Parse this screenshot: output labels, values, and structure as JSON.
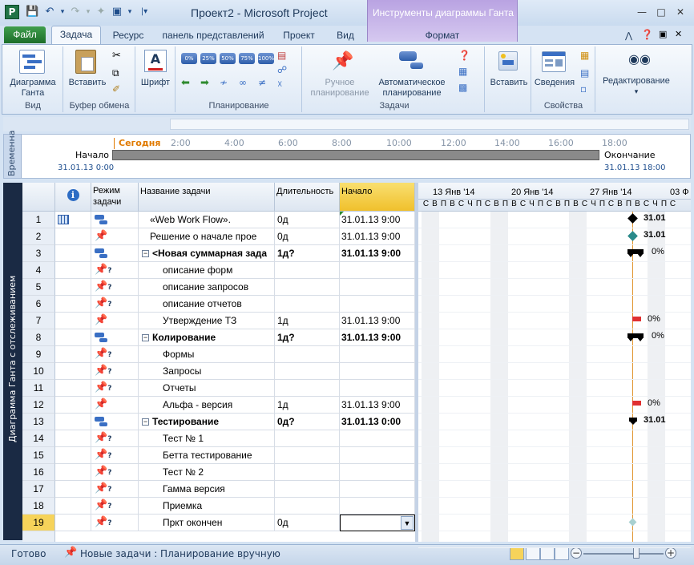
{
  "window": {
    "title": "Проект2 - Microsoft Project",
    "context_tab_title": "Инструменты диаграммы Ганта"
  },
  "ribbon_tabs": {
    "file": "Файл",
    "task": "Задача",
    "resource": "Ресурс",
    "view_panel": "панель представлений",
    "project": "Проект",
    "view": "Вид",
    "format": "Формат"
  },
  "ribbon": {
    "gantt_button": "Диаграмма\nГанта",
    "paste_button": "Вставить",
    "font_button": "Шрифт",
    "manual_schedule": "Ручное\nпланирование",
    "auto_schedule": "Автоматическое\nпланирование",
    "insert_button": "Вставить",
    "info_button": "Сведения",
    "editing_button": "Редактирование",
    "groups": {
      "view": "Вид",
      "clipboard": "Буфер обмена",
      "schedule": "Планирование",
      "tasks": "Задачи",
      "properties": "Свойства"
    },
    "percent_buttons": [
      "0%",
      "25%",
      "50%",
      "75%",
      "100%"
    ]
  },
  "timeline": {
    "side_label": "Временна",
    "today": "Сегодня",
    "ticks": [
      "2:00",
      "4:00",
      "6:00",
      "8:00",
      "10:00",
      "12:00",
      "14:00",
      "16:00",
      "18:00"
    ],
    "start_label": "Начало",
    "start_date": "31.01.13 0:00",
    "end_label": "Окончание",
    "end_date": "31.01.13 18:00"
  },
  "view_bar_label": "Диаграмма Ганта с отслеживанием",
  "grid": {
    "headers": {
      "mode": "Режим\nзадачи",
      "name": "Название задачи",
      "duration": "Длительность",
      "start": "Начало"
    },
    "rows": [
      {
        "id": "1",
        "mode": "auto",
        "name": "«Web Work Flow».",
        "duration": "0д",
        "start": "31.01.13 9:00",
        "bold": false,
        "indent": 1,
        "collapse": false,
        "indicator": "table"
      },
      {
        "id": "2",
        "mode": "manual",
        "name": "Решение о начале прое",
        "duration": "0д",
        "start": "31.01.13 9:00",
        "bold": false,
        "indent": 1,
        "collapse": false
      },
      {
        "id": "3",
        "mode": "auto",
        "name": "<Новая суммарная зада",
        "duration": "1д?",
        "start": "31.01.13 9:00",
        "bold": true,
        "indent": 0,
        "collapse": true
      },
      {
        "id": "4",
        "mode": "manual-q",
        "name": "описание форм",
        "duration": "",
        "start": "",
        "bold": false,
        "indent": 2,
        "collapse": false
      },
      {
        "id": "5",
        "mode": "manual-q",
        "name": "описание запросов",
        "duration": "",
        "start": "",
        "bold": false,
        "indent": 2,
        "collapse": false
      },
      {
        "id": "6",
        "mode": "manual-q",
        "name": "описание отчетов",
        "duration": "",
        "start": "",
        "bold": false,
        "indent": 2,
        "collapse": false
      },
      {
        "id": "7",
        "mode": "manual",
        "name": "Утверждение ТЗ",
        "duration": "1д",
        "start": "31.01.13 9:00",
        "bold": false,
        "indent": 2,
        "collapse": false
      },
      {
        "id": "8",
        "mode": "auto",
        "name": "Колирование",
        "duration": "1д?",
        "start": "31.01.13 9:00",
        "bold": true,
        "indent": 0,
        "collapse": true
      },
      {
        "id": "9",
        "mode": "manual-q",
        "name": "Формы",
        "duration": "",
        "start": "",
        "bold": false,
        "indent": 2,
        "collapse": false
      },
      {
        "id": "10",
        "mode": "manual-q",
        "name": "Запросы",
        "duration": "",
        "start": "",
        "bold": false,
        "indent": 2,
        "collapse": false
      },
      {
        "id": "11",
        "mode": "manual-q",
        "name": "Отчеты",
        "duration": "",
        "start": "",
        "bold": false,
        "indent": 2,
        "collapse": false
      },
      {
        "id": "12",
        "mode": "manual",
        "name": "Альфа - версия",
        "duration": "1д",
        "start": "31.01.13 9:00",
        "bold": false,
        "indent": 2,
        "collapse": false
      },
      {
        "id": "13",
        "mode": "auto",
        "name": "Тестирование",
        "duration": "0д?",
        "start": "31.01.13 0:00",
        "bold": true,
        "indent": 0,
        "collapse": true
      },
      {
        "id": "14",
        "mode": "manual-q",
        "name": "Тест № 1",
        "duration": "",
        "start": "",
        "bold": false,
        "indent": 2,
        "collapse": false
      },
      {
        "id": "15",
        "mode": "manual-q",
        "name": "Бетта тестирование",
        "duration": "",
        "start": "",
        "bold": false,
        "indent": 2,
        "collapse": false
      },
      {
        "id": "16",
        "mode": "manual-q",
        "name": "Тест № 2",
        "duration": "",
        "start": "",
        "bold": false,
        "indent": 2,
        "collapse": false
      },
      {
        "id": "17",
        "mode": "manual-q",
        "name": "Гамма версия",
        "duration": "",
        "start": "",
        "bold": false,
        "indent": 2,
        "collapse": false
      },
      {
        "id": "18",
        "mode": "manual-q",
        "name": "Приемка",
        "duration": "",
        "start": "",
        "bold": false,
        "indent": 2,
        "collapse": false
      },
      {
        "id": "19",
        "mode": "manual-q",
        "name": "Пркт окончен",
        "duration": "0д",
        "start": "",
        "bold": false,
        "indent": 2,
        "collapse": false,
        "selected": true
      }
    ]
  },
  "gantt": {
    "weeks": [
      "13 Янв '14",
      "20 Янв '14",
      "27 Янв '14",
      "03 Ф"
    ],
    "days": [
      "С",
      "В",
      "П",
      "В",
      "С",
      "Ч",
      "П",
      "С",
      "В",
      "П",
      "В",
      "С",
      "Ч",
      "П",
      "С",
      "В",
      "П",
      "В",
      "С",
      "Ч",
      "П",
      "С",
      "В",
      "П",
      "В",
      "С",
      "Ч",
      "П",
      "С"
    ],
    "labels": {
      "r1": "31.01",
      "r2": "31.01",
      "r3": "0%",
      "r7": "0%",
      "r8": "0%",
      "r12": "0%",
      "r13": "31.01"
    },
    "colors": {
      "milestone": "#000000",
      "manual_milestone": "#2a8a8a",
      "manual_bar": "#e03030",
      "today_line": "#e0952f"
    }
  },
  "status": {
    "ready": "Готово",
    "new_tasks": "Новые задачи : Планирование вручную"
  }
}
